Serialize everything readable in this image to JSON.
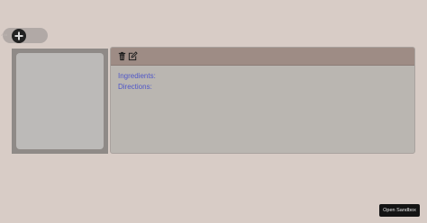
{
  "toolbar": {
    "add_icon": "plus-circle-icon",
    "add_label": "Add"
  },
  "recipe": {
    "ingredients_label": "Ingredients:",
    "directions_label": "Directions:",
    "delete_icon": "trash-icon",
    "edit_icon": "edit-icon"
  },
  "footer": {
    "sandbox_label": "Open Sandbox"
  }
}
